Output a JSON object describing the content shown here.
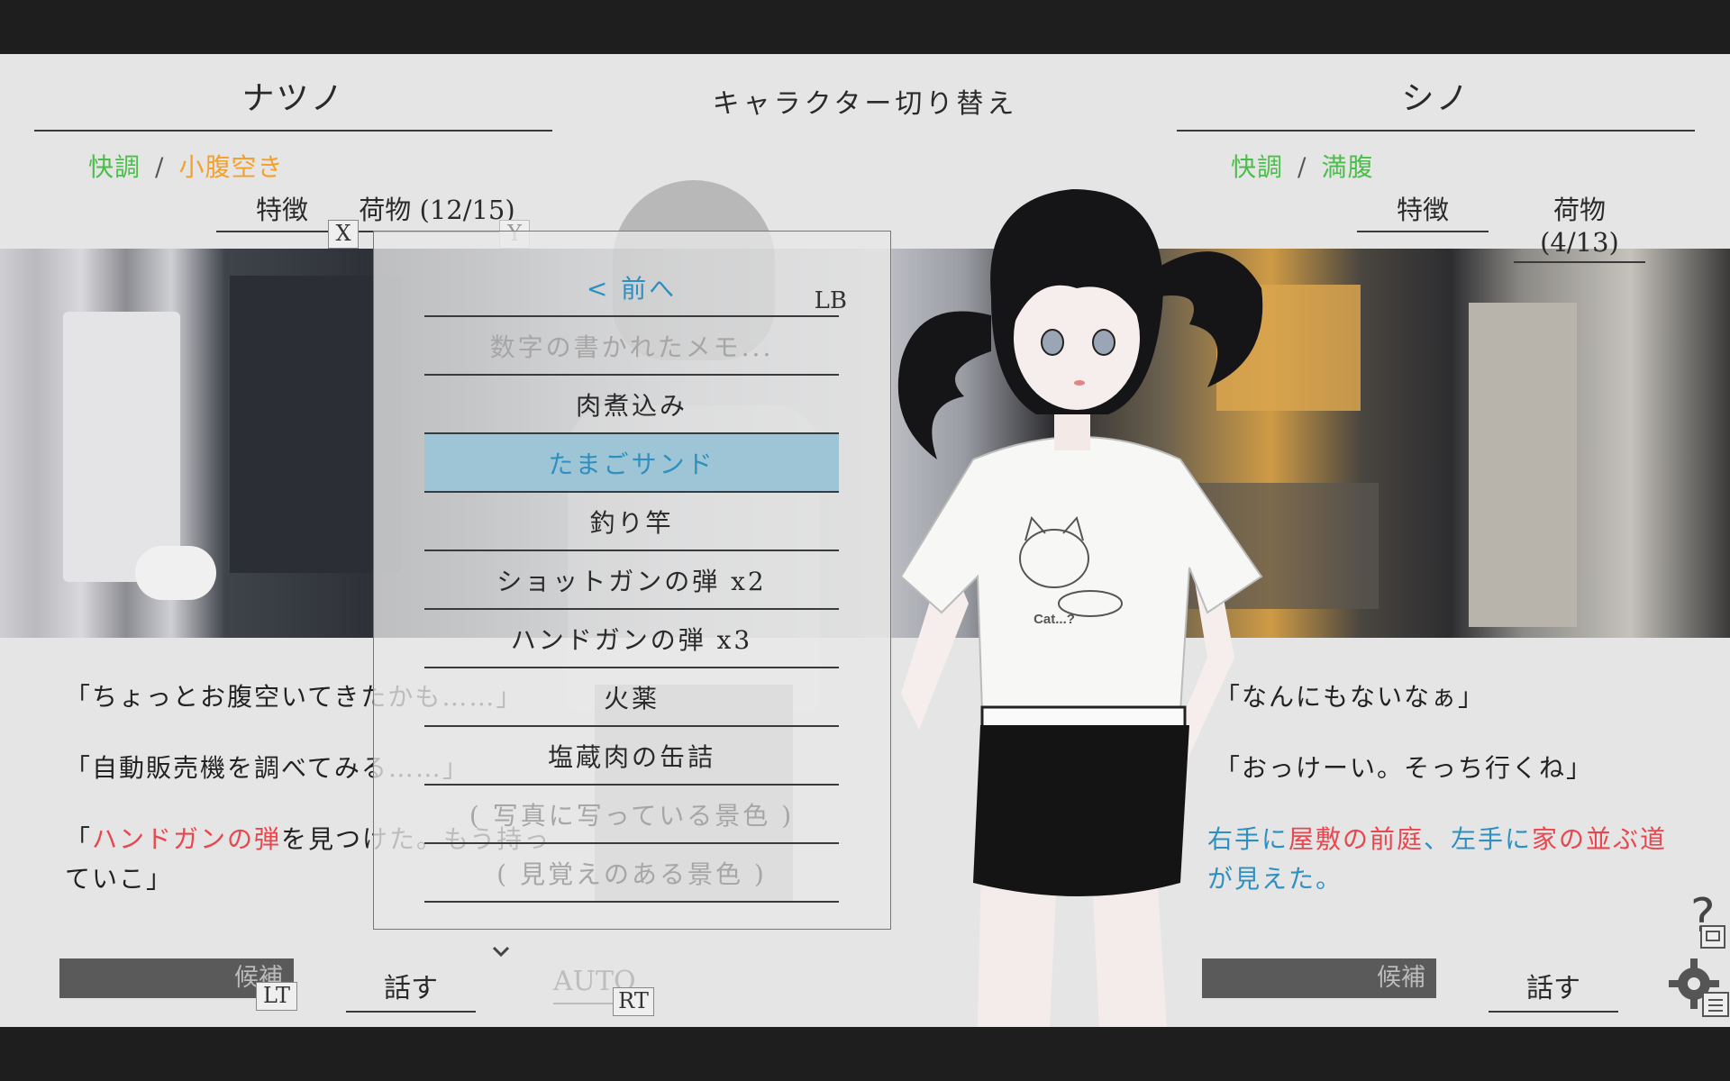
{
  "left_character": {
    "name": "ナツノ",
    "status_condition": "快調",
    "status_separator": "/",
    "status_hunger": "小腹空き",
    "tab_traits": "特徴",
    "tab_inventory": "荷物 (12/15)",
    "key_x": "X",
    "key_y": "Y",
    "dialogue": [
      {
        "text": "「ちょっとお腹空いてきたかも……」"
      },
      {
        "text": "「自動販売機を調べてみる……」"
      },
      {
        "pre": "「",
        "item": "ハンドガンの弾",
        "post": "を見つけた。もう持っ",
        "line2": "ていこ」"
      }
    ],
    "candidate_label": "候補",
    "key_lt": "LT",
    "talk_label": "話す",
    "auto_label": "AUTO",
    "key_rt": "RT"
  },
  "header": {
    "switch_title": "キャラクター切り替え"
  },
  "right_character": {
    "name": "シノ",
    "status_condition": "快調",
    "status_separator": "/",
    "status_hunger": "満腹",
    "tab_traits": "特徴",
    "tab_inventory": "荷物 (4/13)",
    "dialogue": [
      {
        "text": "「なんにもないなぁ」"
      },
      {
        "text": "「おっけーい。そっち行くね」"
      }
    ],
    "narration": {
      "p1": "右手に",
      "p2": "屋敷の前庭",
      "p3": "、左手に",
      "p4": "家の並ぶ道",
      "p5": "が見えた。"
    },
    "candidate_label": "候補",
    "talk_label": "話す"
  },
  "inventory_menu": {
    "prev_label": "< 前へ",
    "key_lb": "LB",
    "items": [
      "数字の書かれたメモ...",
      "肉煮込み",
      "たまごサンド",
      "釣り竿",
      "ショットガンの弾 x2",
      "ハンドガンの弾 x3",
      "火薬",
      "塩蔵肉の缶詰",
      "( 写真に写っている景色 )",
      "( 見覚えのある景色 )"
    ],
    "selected_index": 2,
    "more_icon": "chevron-down-icon"
  },
  "shirt_text": "Cat...?",
  "colors": {
    "good": "#4bbd4b",
    "hungry": "#f3a02d",
    "highlight": "#9ec5d6",
    "item_red": "#e8474e",
    "place_blue": "#2f8fbf"
  },
  "icons": [
    "help-icon",
    "settings-gear-icon",
    "chevron-down-icon"
  ]
}
